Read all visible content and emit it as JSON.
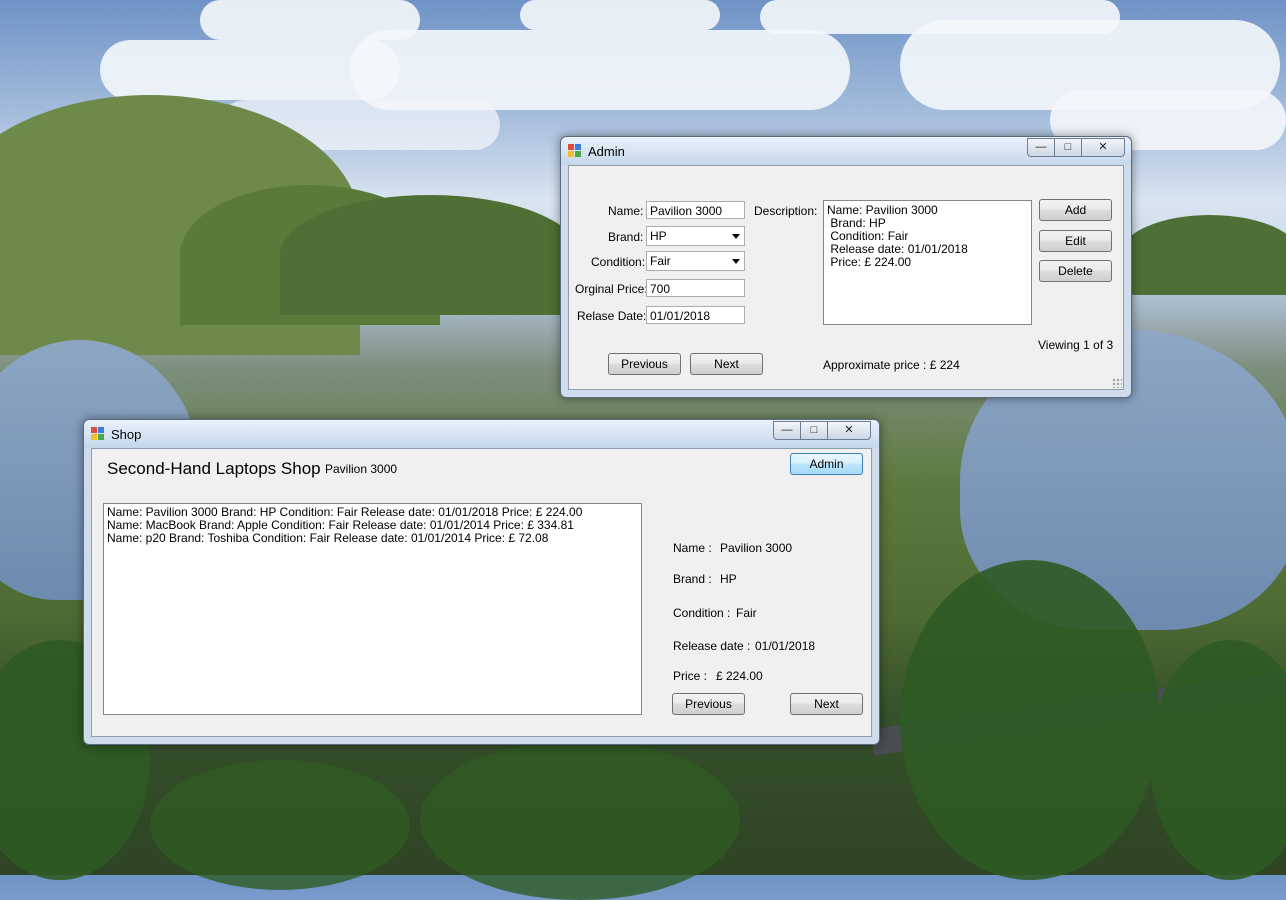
{
  "admin_window": {
    "title": "Admin",
    "labels": {
      "name": "Name:",
      "brand": "Brand:",
      "condition": "Condition:",
      "original_price": "Orginal Price:",
      "release_date": "Relase Date:",
      "description": "Description:"
    },
    "fields": {
      "name": "Pavilion 3000",
      "brand": "HP",
      "condition": "Fair",
      "original_price": "700",
      "release_date": "01/01/2018"
    },
    "description_lines": [
      "Name: Pavilion 3000",
      " Brand: HP",
      " Condition: Fair",
      " Release date: 01/01/2018",
      " Price: £ 224.00"
    ],
    "buttons": {
      "add": "Add",
      "edit": "Edit",
      "delete": "Delete",
      "previous": "Previous",
      "next": "Next"
    },
    "viewing": "Viewing 1 of 3",
    "approx_price": "Approximate price : £ 224"
  },
  "shop_window": {
    "title": "Shop",
    "heading": "Second-Hand Laptops Shop",
    "selected_name": "Pavilion 3000",
    "admin_button": "Admin",
    "list_items": [
      "Name: Pavilion 3000 Brand: HP Condition: Fair Release date: 01/01/2018 Price: £ 224.00",
      "Name: MacBook Brand: Apple Condition: Fair Release date: 01/01/2014 Price: £ 334.81",
      "Name: p20 Brand: Toshiba Condition: Fair Release date: 01/01/2014 Price: £ 72.08"
    ],
    "details": {
      "name_label": "Name :",
      "name_value": "Pavilion 3000",
      "brand_label": "Brand :",
      "brand_value": "HP",
      "condition_label": "Condition :",
      "condition_value": "Fair",
      "release_label": "Release date :",
      "release_value": "01/01/2018",
      "price_label": "Price :",
      "price_value": "£ 224.00"
    },
    "buttons": {
      "previous": "Previous",
      "next": "Next"
    }
  },
  "caption_buttons": {
    "minimize": "—",
    "maximize": "□",
    "close": "✕"
  }
}
